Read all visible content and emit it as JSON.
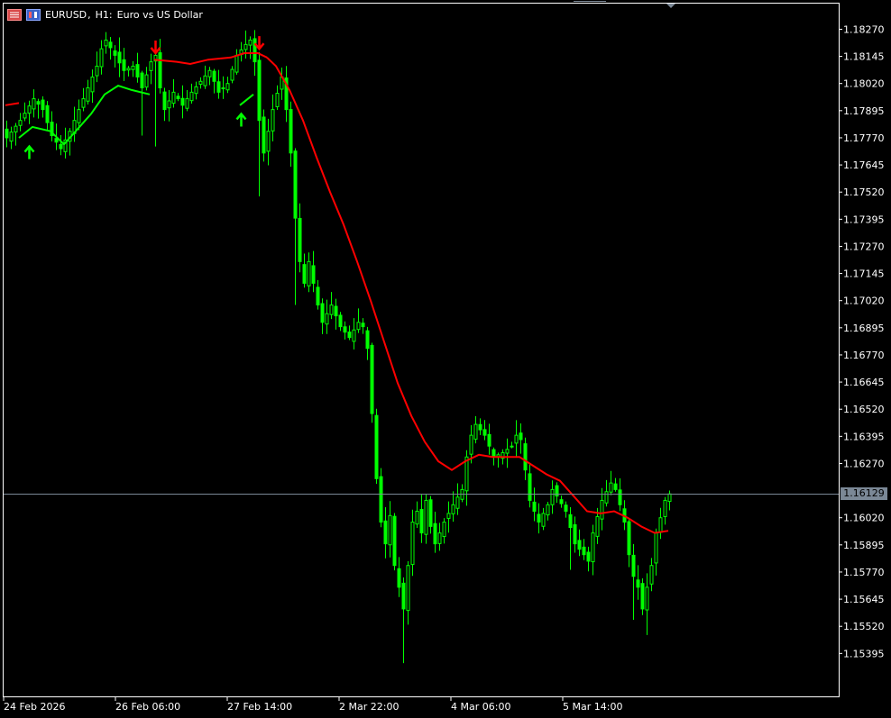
{
  "chart_data": {
    "type": "candlestick",
    "symbol": "EURUSD",
    "timeframe": "H1:",
    "description": "Euro vs US Dollar",
    "colors": {
      "background": "#000000",
      "frame": "#ffffff",
      "candles": "#00ff00",
      "ma_up": "#00ff00",
      "ma_down": "#ff0000",
      "current_price_line": "#7b8896",
      "current_price_badge": "#7b8896"
    },
    "ylim": [
      1.1533,
      1.1833
    ],
    "yticks": [
      "1.18270",
      "1.18145",
      "1.18020",
      "1.17895",
      "1.17770",
      "1.17645",
      "1.17520",
      "1.17395",
      "1.17270",
      "1.17145",
      "1.17020",
      "1.16895",
      "1.16770",
      "1.16645",
      "1.16520",
      "1.16395",
      "1.16270",
      "1.16020",
      "1.15895",
      "1.15770",
      "1.15645",
      "1.15520",
      "1.15395"
    ],
    "xticks": [
      "24 Feb 2026",
      "26 Feb 06:00",
      "27 Feb 14:00",
      "2 Mar 22:00",
      "4 Mar 06:00",
      "5 Mar 14:00"
    ],
    "current_price": "1.16129",
    "candle_count": 148,
    "close_points": [
      [
        0,
        1.1777
      ],
      [
        3,
        1.1785
      ],
      [
        6,
        1.1795
      ],
      [
        8,
        1.179
      ],
      [
        10,
        1.1778
      ],
      [
        12,
        1.1772
      ],
      [
        14,
        1.178
      ],
      [
        16,
        1.179
      ],
      [
        18,
        1.18
      ],
      [
        20,
        1.181
      ],
      [
        21,
        1.1818
      ],
      [
        22,
        1.1822
      ],
      [
        24,
        1.1815
      ],
      [
        26,
        1.1808
      ],
      [
        28,
        1.181
      ],
      [
        30,
        1.18
      ],
      [
        32,
        1.1812
      ],
      [
        33,
        1.1815
      ],
      [
        34,
        1.18
      ],
      [
        35,
        1.179
      ],
      [
        37,
        1.1798
      ],
      [
        39,
        1.1792
      ],
      [
        41,
        1.1798
      ],
      [
        43,
        1.1803
      ],
      [
        45,
        1.1808
      ],
      [
        47,
        1.1798
      ],
      [
        49,
        1.1802
      ],
      [
        51,
        1.1815
      ],
      [
        53,
        1.182
      ],
      [
        54,
        1.1822
      ],
      [
        55,
        1.1812
      ],
      [
        56,
        1.1785
      ],
      [
        57,
        1.177
      ],
      [
        59,
        1.179
      ],
      [
        61,
        1.1805
      ],
      [
        62,
        1.179
      ],
      [
        63,
        1.177
      ],
      [
        64,
        1.174
      ],
      [
        65,
        1.172
      ],
      [
        66,
        1.171
      ],
      [
        67,
        1.172
      ],
      [
        68,
        1.171
      ],
      [
        69,
        1.17
      ],
      [
        70,
        1.1692
      ],
      [
        72,
        1.17
      ],
      [
        74,
        1.169
      ],
      [
        76,
        1.1685
      ],
      [
        78,
        1.1692
      ],
      [
        79,
        1.169
      ],
      [
        80,
        1.168
      ],
      [
        81,
        1.165
      ],
      [
        82,
        1.162
      ],
      [
        83,
        1.16
      ],
      [
        84,
        1.159
      ],
      [
        85,
        1.1603
      ],
      [
        86,
        1.158
      ],
      [
        87,
        1.157
      ],
      [
        88,
        1.156
      ],
      [
        89,
        1.158
      ],
      [
        90,
        1.16
      ],
      [
        91,
        1.1605
      ],
      [
        92,
        1.1595
      ],
      [
        93,
        1.161
      ],
      [
        94,
        1.1598
      ],
      [
        95,
        1.159
      ],
      [
        97,
        1.16
      ],
      [
        99,
        1.1608
      ],
      [
        101,
        1.1615
      ],
      [
        102,
        1.163
      ],
      [
        103,
        1.164
      ],
      [
        104,
        1.1645
      ],
      [
        106,
        1.164
      ],
      [
        108,
        1.163
      ],
      [
        110,
        1.1632
      ],
      [
        112,
        1.1635
      ],
      [
        113,
        1.164
      ],
      [
        114,
        1.1638
      ],
      [
        116,
        1.161
      ],
      [
        118,
        1.16
      ],
      [
        120,
        1.1608
      ],
      [
        121,
        1.1615
      ],
      [
        122,
        1.1612
      ],
      [
        124,
        1.1605
      ],
      [
        126,
        1.159
      ],
      [
        128,
        1.1585
      ],
      [
        129,
        1.1582
      ],
      [
        130,
        1.1595
      ],
      [
        132,
        1.161
      ],
      [
        134,
        1.1618
      ],
      [
        135,
        1.1615
      ],
      [
        136,
        1.1608
      ],
      [
        137,
        1.16
      ],
      [
        138,
        1.1585
      ],
      [
        139,
        1.1575
      ],
      [
        140,
        1.157
      ],
      [
        141,
        1.156
      ],
      [
        142,
        1.157
      ],
      [
        143,
        1.158
      ],
      [
        144,
        1.1595
      ],
      [
        145,
        1.1602
      ],
      [
        146,
        1.161
      ],
      [
        147,
        1.1613
      ]
    ],
    "spike_lows": [
      {
        "i": 30,
        "low": 1.1778
      },
      {
        "i": 33,
        "low": 1.1773
      },
      {
        "i": 56,
        "low": 1.175
      },
      {
        "i": 64,
        "low": 1.17
      },
      {
        "i": 88,
        "low": 1.1535
      },
      {
        "i": 125,
        "low": 1.1578
      },
      {
        "i": 139,
        "low": 1.1555
      },
      {
        "i": 142,
        "low": 1.1548
      }
    ],
    "moving_average": [
      {
        "color": "ma_down",
        "points": [
          [
            0,
            1.1792
          ],
          [
            3,
            1.1793
          ]
        ]
      },
      {
        "color": "ma_up",
        "points": [
          [
            3,
            1.1777
          ],
          [
            6,
            1.1782
          ],
          [
            10,
            1.178
          ],
          [
            13,
            1.1774
          ],
          [
            16,
            1.1781
          ],
          [
            19,
            1.1788
          ],
          [
            22,
            1.1797
          ],
          [
            25,
            1.1801
          ],
          [
            28,
            1.1799
          ],
          [
            32,
            1.1797
          ]
        ]
      },
      {
        "color": "ma_down",
        "points": [
          [
            33,
            1.1813
          ],
          [
            38,
            1.1812
          ],
          [
            41,
            1.1811
          ],
          [
            45,
            1.1813
          ],
          [
            50,
            1.1814
          ],
          [
            53,
            1.1816
          ],
          [
            56,
            1.1816
          ],
          [
            58,
            1.1814
          ]
        ]
      },
      {
        "color": "ma_up",
        "points": [
          [
            52,
            1.1792
          ],
          [
            55,
            1.1797
          ]
        ]
      },
      {
        "color": "ma_down",
        "points": [
          [
            58,
            1.1814
          ],
          [
            60,
            1.181
          ],
          [
            63,
            1.1799
          ],
          [
            66,
            1.1785
          ],
          [
            69,
            1.1768
          ],
          [
            72,
            1.1752
          ],
          [
            75,
            1.1737
          ],
          [
            78,
            1.172
          ],
          [
            81,
            1.1702
          ],
          [
            84,
            1.1683
          ],
          [
            87,
            1.1664
          ],
          [
            90,
            1.1649
          ],
          [
            93,
            1.1637
          ],
          [
            96,
            1.1628
          ],
          [
            99,
            1.1624
          ],
          [
            102,
            1.1628
          ],
          [
            105,
            1.1631
          ],
          [
            108,
            1.163
          ],
          [
            111,
            1.163
          ],
          [
            114,
            1.163
          ],
          [
            117,
            1.1626
          ],
          [
            120,
            1.1622
          ],
          [
            123,
            1.1619
          ],
          [
            126,
            1.1612
          ],
          [
            129,
            1.1605
          ],
          [
            132,
            1.1604
          ],
          [
            135,
            1.1605
          ],
          [
            138,
            1.1602
          ],
          [
            141,
            1.1598
          ],
          [
            144,
            1.1595
          ],
          [
            147,
            1.1596
          ]
        ]
      }
    ],
    "signals": [
      {
        "type": "buy",
        "i": 5,
        "price": 1.1773
      },
      {
        "type": "sell",
        "i": 33,
        "price": 1.1816
      },
      {
        "type": "sell",
        "i": 56,
        "price": 1.1818
      },
      {
        "type": "buy",
        "i": 52,
        "price": 1.1788
      }
    ]
  }
}
